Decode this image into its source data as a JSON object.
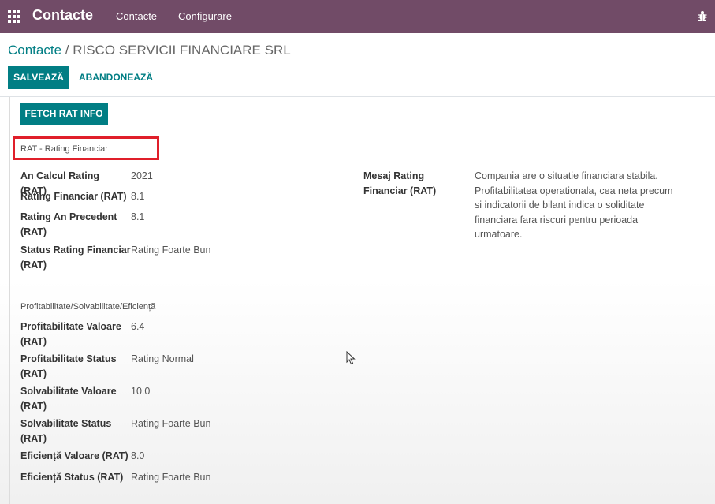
{
  "navbar": {
    "brand": "Contacte",
    "menu": [
      "Contacte",
      "Configurare"
    ]
  },
  "breadcrumb": {
    "parent": "Contacte",
    "separator": " / ",
    "current": "RISCO SERVICII FINANCIARE SRL"
  },
  "actions": {
    "save": "SALVEAZĂ",
    "discard": "ABANDONEAZĂ"
  },
  "form": {
    "fetch_button": "FETCH RAT INFO",
    "rat_group": {
      "title": "RAT - Rating Financiar",
      "fields": [
        {
          "label": "An Calcul Rating (RAT)",
          "value": "2021"
        },
        {
          "label": "Rating Financiar (RAT)",
          "value": "8.1"
        },
        {
          "label": "Rating An Precedent (RAT)",
          "value": "8.1"
        },
        {
          "label": "Status Rating Financiar (RAT)",
          "value": "Rating Foarte Bun"
        }
      ],
      "message": {
        "label": "Mesaj Rating Financiar (RAT)",
        "value": "Compania are o situatie financiara stabila. Profitabilitatea operationala, cea neta precum si indicatorii de bilant indica o soliditate financiara fara riscuri pentru perioada urmatoare."
      }
    },
    "profit_group": {
      "title": "Profitabilitate/Solvabilitate/Eficiență",
      "fields": [
        {
          "label": "Profitabilitate Valoare (RAT)",
          "value": "6.4"
        },
        {
          "label": "Profitabilitate Status (RAT)",
          "value": "Rating Normal"
        },
        {
          "label": "Solvabilitate Valoare (RAT)",
          "value": "10.0"
        },
        {
          "label": "Solvabilitate Status (RAT)",
          "value": "Rating Foarte Bun"
        },
        {
          "label": "Eficiență Valoare (RAT)",
          "value": "8.0"
        },
        {
          "label": "Eficiență Status (RAT)",
          "value": "Rating Foarte Bun"
        }
      ]
    }
  },
  "colors": {
    "navbar": "#714b67",
    "primary": "#017e84",
    "highlight": "#e01f2a"
  }
}
